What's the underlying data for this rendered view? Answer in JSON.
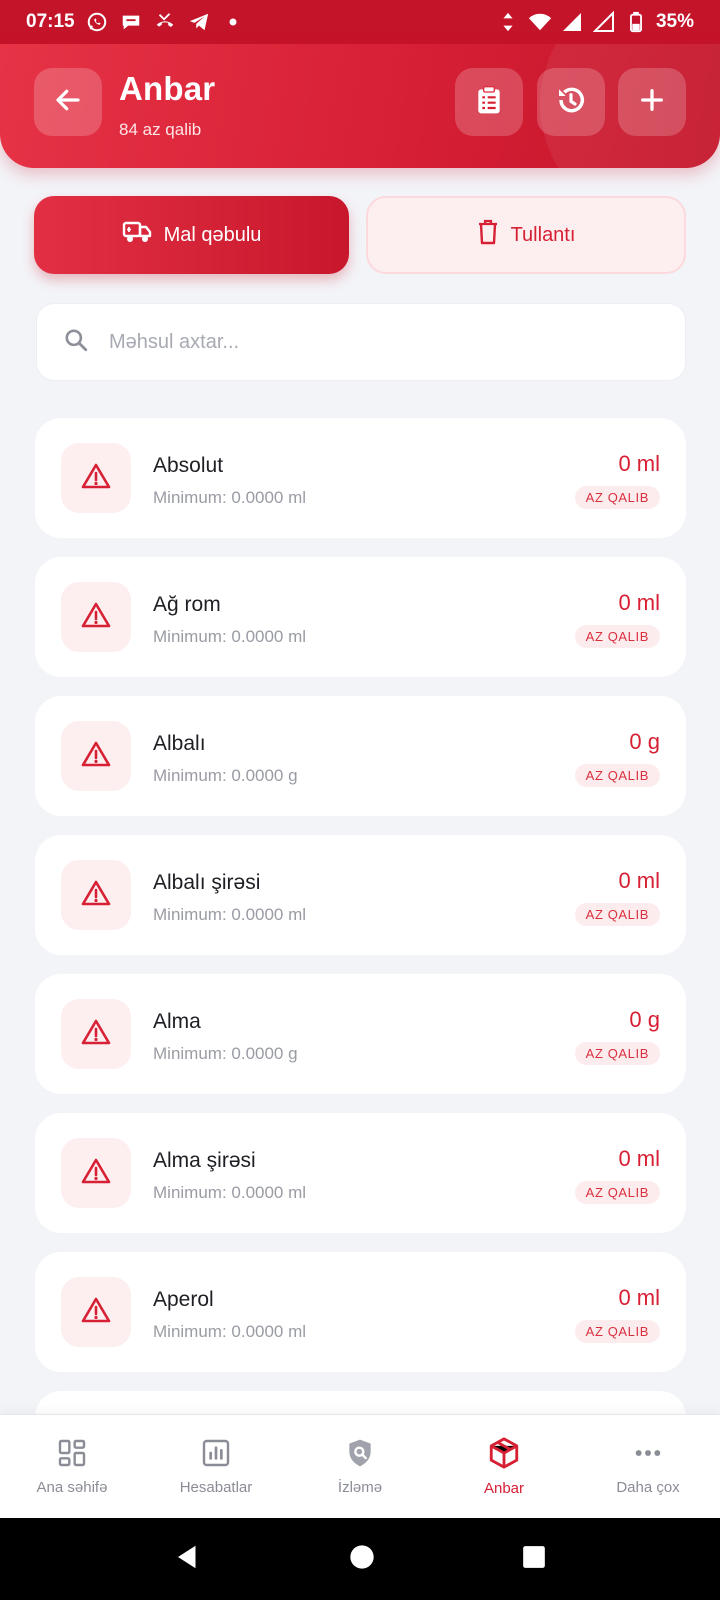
{
  "status_bar": {
    "time": "07:15",
    "battery": "35%",
    "icons": [
      "whatsapp-icon",
      "chat-icon",
      "missed-call-icon",
      "telegram-icon",
      "dot-icon",
      "data-arrows-icon",
      "wifi-icon",
      "signal-icon",
      "signal-icon",
      "battery-icon"
    ]
  },
  "header": {
    "title": "Anbar",
    "subtitle": "84 az qalib",
    "buttons": [
      "back-arrow-icon",
      "clipboard-list-icon",
      "history-icon",
      "plus-icon"
    ]
  },
  "actions": {
    "receive_label": "Mal qəbulu",
    "waste_label": "Tullantı"
  },
  "search": {
    "placeholder": "Məhsul axtar...",
    "value": ""
  },
  "items": [
    {
      "name": "Absolut",
      "min": "Minimum: 0.0000 ml",
      "qty": "0 ml",
      "badge": "AZ QALIB"
    },
    {
      "name": "Ağ rom",
      "min": "Minimum: 0.0000 ml",
      "qty": "0 ml",
      "badge": "AZ QALIB"
    },
    {
      "name": "Albalı",
      "min": "Minimum: 0.0000 g",
      "qty": "0 g",
      "badge": "AZ QALIB"
    },
    {
      "name": "Albalı şirəsi",
      "min": "Minimum: 0.0000 ml",
      "qty": "0 ml",
      "badge": "AZ QALIB"
    },
    {
      "name": "Alma",
      "min": "Minimum: 0.0000 g",
      "qty": "0 g",
      "badge": "AZ QALIB"
    },
    {
      "name": "Alma şirəsi",
      "min": "Minimum: 0.0000 ml",
      "qty": "0 ml",
      "badge": "AZ QALIB"
    },
    {
      "name": "Aperol",
      "min": "Minimum: 0.0000 ml",
      "qty": "0 ml",
      "badge": "AZ QALIB"
    }
  ],
  "bottom_nav": [
    {
      "label": "Ana səhifə",
      "icon": "dashboard-icon",
      "active": false
    },
    {
      "label": "Hesabatlar",
      "icon": "report-chart-icon",
      "active": false
    },
    {
      "label": "İzləmə",
      "icon": "shield-search-icon",
      "active": false
    },
    {
      "label": "Anbar",
      "icon": "box-icon",
      "active": true
    },
    {
      "label": "Daha çox",
      "icon": "more-dots-icon",
      "active": false
    }
  ],
  "colors": {
    "brand_red": "#d72034",
    "header_gradient_start": "#e63346",
    "header_gradient_end": "#c4162b",
    "badge_bg": "#fdecee",
    "background": "#f3f4f8"
  }
}
